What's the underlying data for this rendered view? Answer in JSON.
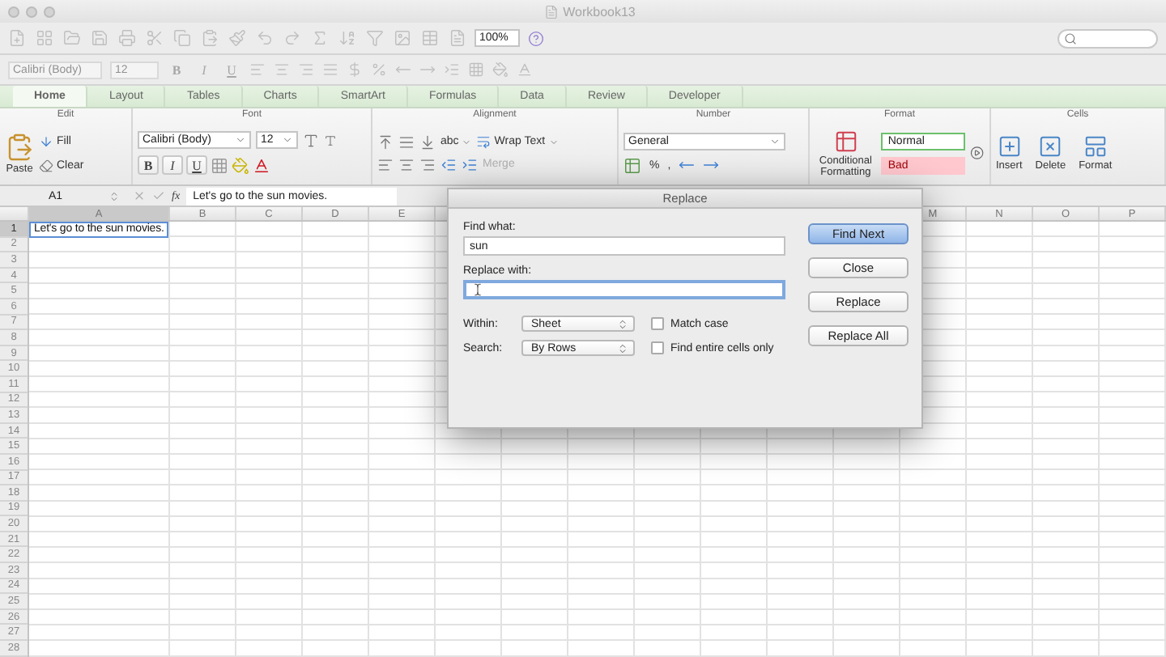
{
  "window": {
    "title": "Workbook13"
  },
  "standard_toolbar": {
    "zoom": "100%",
    "disabled": true
  },
  "format_toolbar": {
    "font": "Calibri (Body)",
    "size": "12",
    "styles": [
      "B",
      "I",
      "U"
    ],
    "disabled": true
  },
  "ribbon_tabs": [
    {
      "label": "Home",
      "selected": true
    },
    {
      "label": "Layout",
      "selected": false
    },
    {
      "label": "Tables",
      "selected": false
    },
    {
      "label": "Charts",
      "selected": false
    },
    {
      "label": "SmartArt",
      "selected": false
    },
    {
      "label": "Formulas",
      "selected": false
    },
    {
      "label": "Data",
      "selected": false
    },
    {
      "label": "Review",
      "selected": false
    },
    {
      "label": "Developer",
      "selected": false
    }
  ],
  "ribbon": {
    "edit": {
      "title": "Edit",
      "paste": "Paste",
      "fill": "Fill",
      "clear": "Clear"
    },
    "font": {
      "title": "Font",
      "name": "Calibri (Body)",
      "size": "12",
      "styles": [
        "B",
        "I",
        "U"
      ]
    },
    "alignment": {
      "title": "Alignment",
      "wrap_button": "abc",
      "wrap_text": "Wrap Text",
      "merge": {
        "label": "Merge",
        "disabled": true
      }
    },
    "number": {
      "title": "Number",
      "format": "General",
      "percent": "%",
      "comma": ","
    },
    "format": {
      "title": "Format",
      "conditional": "Conditional Formatting",
      "styles": [
        {
          "label": "Normal",
          "color": "#ffffff"
        },
        {
          "label": "Bad",
          "color": "#ffc7ce"
        }
      ]
    },
    "cells": {
      "title": "Cells",
      "buttons": [
        "Insert",
        "Delete",
        "Format"
      ]
    }
  },
  "formula_bar": {
    "cell_ref": "A1",
    "fx": "fx",
    "content": "Let's go to the sun movies."
  },
  "sheet": {
    "columns_left": [
      "A",
      "B",
      "C",
      "D",
      "E"
    ],
    "columns_right": [
      "M",
      "N",
      "O",
      "P"
    ],
    "row_numbers": [
      "1",
      "2",
      "3",
      "4",
      "5",
      "6",
      "7",
      "8",
      "9",
      "10",
      "11",
      "12",
      "13",
      "14",
      "15",
      "16",
      "17",
      "18",
      "19",
      "20",
      "21",
      "22",
      "23",
      "24",
      "25",
      "26",
      "27",
      "28"
    ],
    "cell_a1": {
      "value": "Let's go to the sun movies.",
      "selected": true
    }
  },
  "dialog": {
    "title": "Replace",
    "find_label": "Find what:",
    "find_value": "sun",
    "replace_label": "Replace with:",
    "replace_focused": true,
    "within_label": "Within:",
    "within": "Sheet",
    "search_label": "Search:",
    "search": "By Rows",
    "options": [
      {
        "label": "Match case",
        "checked": false
      },
      {
        "label": "Find entire cells only",
        "checked": false
      }
    ],
    "buttons": [
      {
        "label": "Find Next",
        "default": true
      },
      {
        "label": "Close",
        "default": false
      },
      {
        "label": "Replace",
        "default": false
      },
      {
        "label": "Replace All",
        "default": false
      }
    ]
  }
}
